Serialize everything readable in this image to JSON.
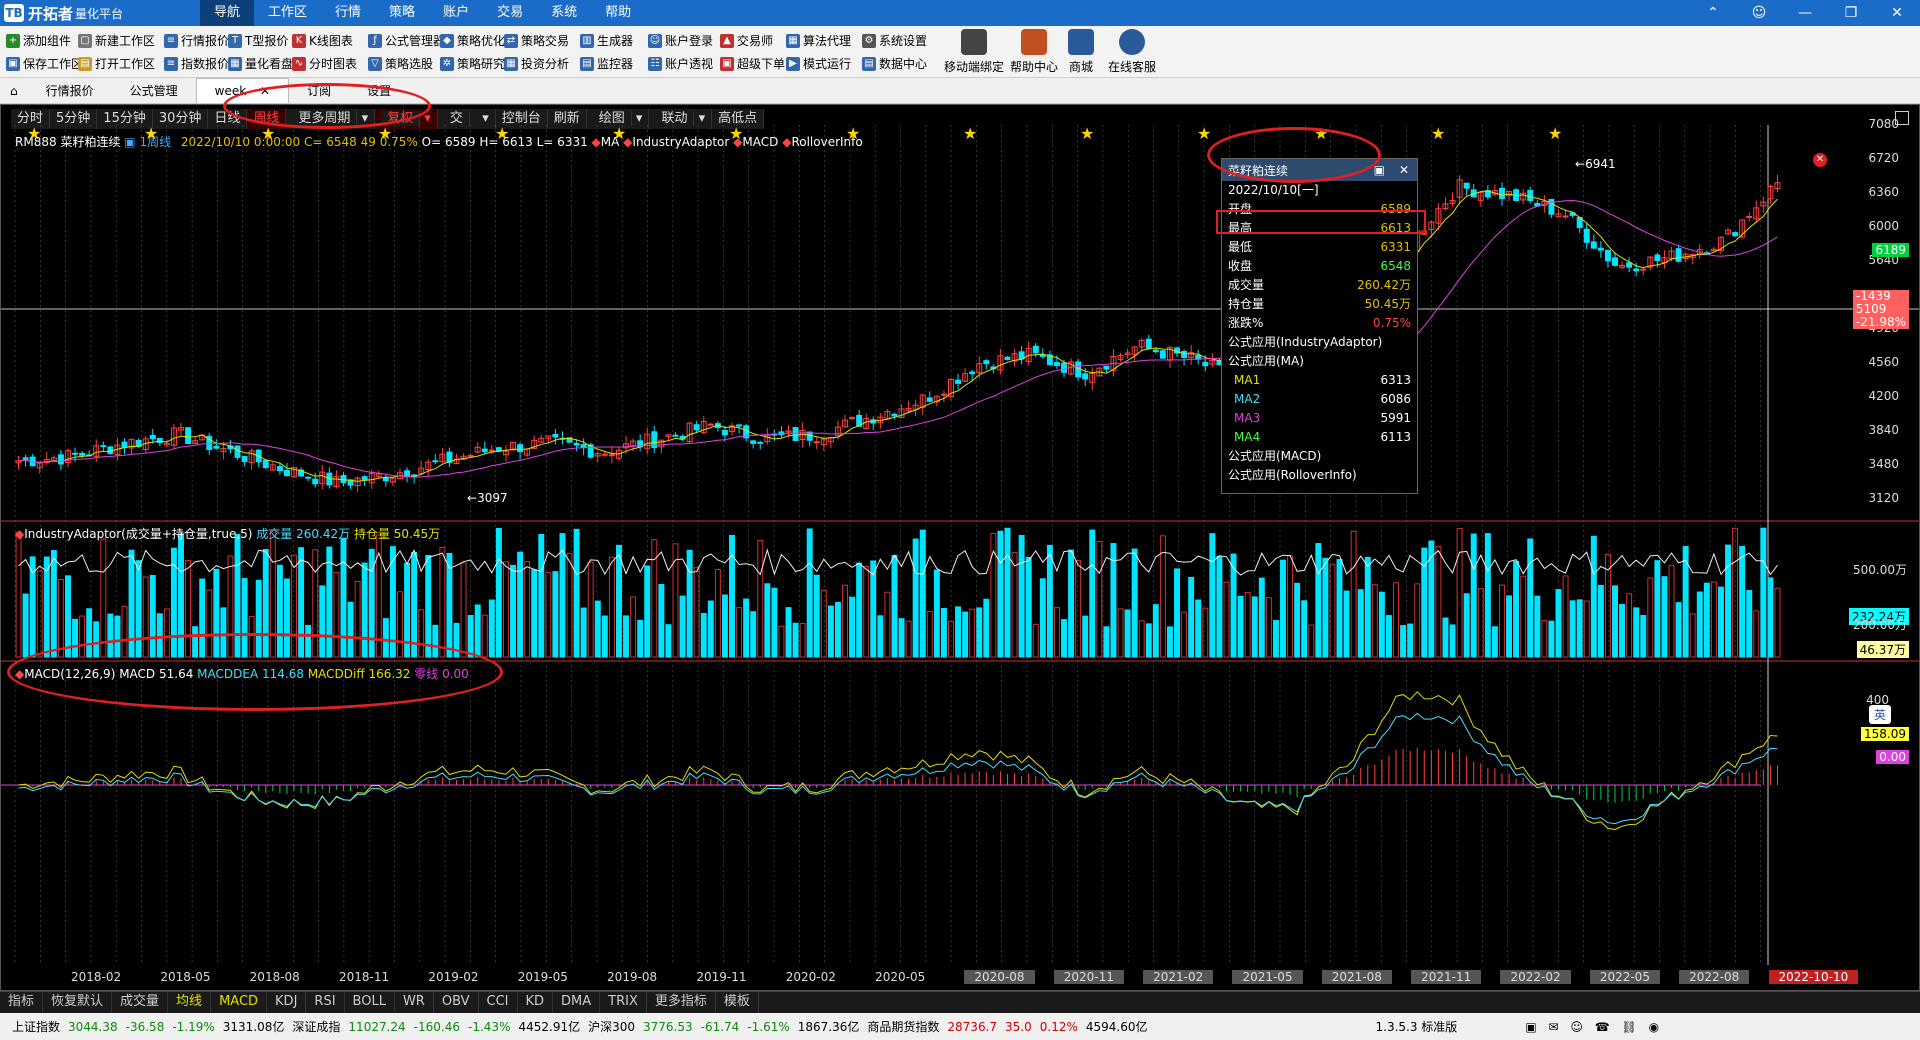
{
  "app": {
    "logo_text": "开拓者",
    "logo_sub": "量化平台",
    "menu": [
      "导航",
      "工作区",
      "行情",
      "策略",
      "账户",
      "交易",
      "系统",
      "帮助"
    ]
  },
  "ribbon": {
    "col1": [
      "添加组件",
      "保存工作区"
    ],
    "col2": [
      "新建工作区",
      "打开工作区"
    ],
    "col3": [
      "行情报价",
      "指数报价"
    ],
    "col4": [
      "T型报价",
      "量化看盘"
    ],
    "col5": [
      "K线图表",
      "分时图表"
    ],
    "col6": [
      "公式管理器",
      "策略选股"
    ],
    "col7": [
      "策略优化",
      "策略研究"
    ],
    "col8": [
      "策略交易",
      "投资分析"
    ],
    "col9": [
      "生成器",
      "监控器"
    ],
    "col10": [
      "账户登录",
      "账户透视"
    ],
    "col11": [
      "交易师",
      "超级下单"
    ],
    "col12": [
      "算法代理",
      "模式运行"
    ],
    "col13": [
      "系统设置",
      "数据中心"
    ],
    "big": [
      "移动端绑定",
      "帮助中心",
      "商城",
      "在线客服"
    ]
  },
  "tabs": [
    "行情报价",
    "公式管理",
    "week",
    "订阅",
    "设置"
  ],
  "periods": [
    "分时",
    "5分钟",
    "15分钟",
    "30分钟",
    "日线",
    "周线",
    "更多周期",
    "复权",
    "交",
    "控制台",
    "刷新",
    "绘图",
    "联动",
    "高低点"
  ],
  "info": {
    "symbol": "RM888",
    "name": "菜籽粕连续",
    "period": "1周线",
    "date": "2022/10/10 0:00:00",
    "c": "C= 6548",
    "vol": "49",
    "chg": "0.75%",
    "o": "O= 6589",
    "h": "H= 6613",
    "l": "L= 6331",
    "indicators": [
      "MA",
      "IndustryAdaptor",
      "MACD",
      "RolloverInfo"
    ]
  },
  "yaxis_main": [
    "7080",
    "6720",
    "6360",
    "6000",
    "5640",
    "4920",
    "4560",
    "4200",
    "3840",
    "3480",
    "3120"
  ],
  "price_tag": "6189",
  "cross_tag": [
    "-1439",
    "5109",
    "-21.98%"
  ],
  "hi_label": "6941",
  "lo_label": "3097",
  "popup": {
    "title": "菜籽粕连续",
    "date": "2022/10/10[一]",
    "rows": [
      [
        "开盘",
        "6589"
      ],
      [
        "最高",
        "6613"
      ],
      [
        "最低",
        "6331"
      ],
      [
        "收盘",
        "6548"
      ],
      [
        "成交量",
        "260.42万"
      ],
      [
        "持仓量",
        "50.45万"
      ],
      [
        "涨跌%",
        "0.75%"
      ]
    ],
    "f1": "公式应用(IndustryAdaptor)",
    "f2": "公式应用(MA)",
    "ma": [
      [
        "MA1",
        "6313"
      ],
      [
        "MA2",
        "6086"
      ],
      [
        "MA3",
        "5991"
      ],
      [
        "MA4",
        "6113"
      ]
    ],
    "f3": "公式应用(MACD)",
    "f4": "公式应用(RolloverInfo)"
  },
  "panel2": {
    "head": "IndustryAdaptor(成交量+持仓量,true,5)",
    "vol_label": "成交量 260.42万",
    "oi_label": "持仓量 50.45万",
    "ticks": [
      "500.00万",
      "232.24万",
      "200.00万",
      "46.37万"
    ]
  },
  "panel3": {
    "head": "MACD(12,26,9)",
    "macd": "MACD 51.64",
    "dea": "MACDDEA 114.68",
    "diff": "MACDDiff 166.32",
    "zero": "零线 0.00",
    "ticks": [
      "400",
      "158.09",
      "0.00"
    ]
  },
  "xaxis": [
    "2018-02",
    "2018-05",
    "2018-08",
    "2018-11",
    "2019-02",
    "2019-05",
    "2019-08",
    "2019-11",
    "2020-02",
    "2020-05",
    "2020-08",
    "2020-11",
    "2021-02",
    "2021-05",
    "2021-08",
    "2021-11",
    "2022-02",
    "2022-05",
    "2022-08",
    "2022-10-10"
  ],
  "bottom_tabs": [
    "指标",
    "恢复默认",
    "成交量",
    "均线",
    "MACD",
    "KDJ",
    "RSI",
    "BOLL",
    "WR",
    "OBV",
    "CCI",
    "KD",
    "DMA",
    "TRIX",
    "更多指标",
    "模板"
  ],
  "status": {
    "sh": "上证指数",
    "sh_v": "3044.38",
    "sh_c": "-36.58",
    "sh_p": "-1.19%",
    "sh_a": "3131.08亿",
    "sz": "深证成指",
    "sz_v": "11027.24",
    "sz_c": "-160.46",
    "sz_p": "-1.43%",
    "sz_a": "4452.91亿",
    "hs": "沪深300",
    "hs_v": "3776.53",
    "hs_c": "-61.74",
    "hs_p": "-1.61%",
    "hs_a": "1867.36亿",
    "cf": "商品期货指数",
    "cf_v": "28736.7",
    "cf_c": "35.0",
    "cf_p": "0.12%",
    "cf_a": "4594.60亿",
    "ver": "1.3.5.3 标准版"
  },
  "ime": "英",
  "chart_data": {
    "type": "candlestick",
    "title": "菜籽粕连续 RM888 1周线",
    "x_range": [
      "2018-01",
      "2022-10"
    ],
    "ylim": [
      2900,
      7200
    ],
    "high": 6941,
    "low": 3097,
    "last_close": 6548,
    "closes_approx": [
      3400,
      3450,
      3600,
      3700,
      3500,
      3300,
      3150,
      3250,
      3400,
      3550,
      3600,
      3500,
      3650,
      3800,
      3650,
      3700,
      3900,
      4100,
      4500,
      4600,
      4400,
      4700,
      4550,
      4300,
      4100,
      4600,
      5800,
      6500,
      6400,
      6200,
      5600,
      5700,
      5900,
      6548
    ]
  }
}
